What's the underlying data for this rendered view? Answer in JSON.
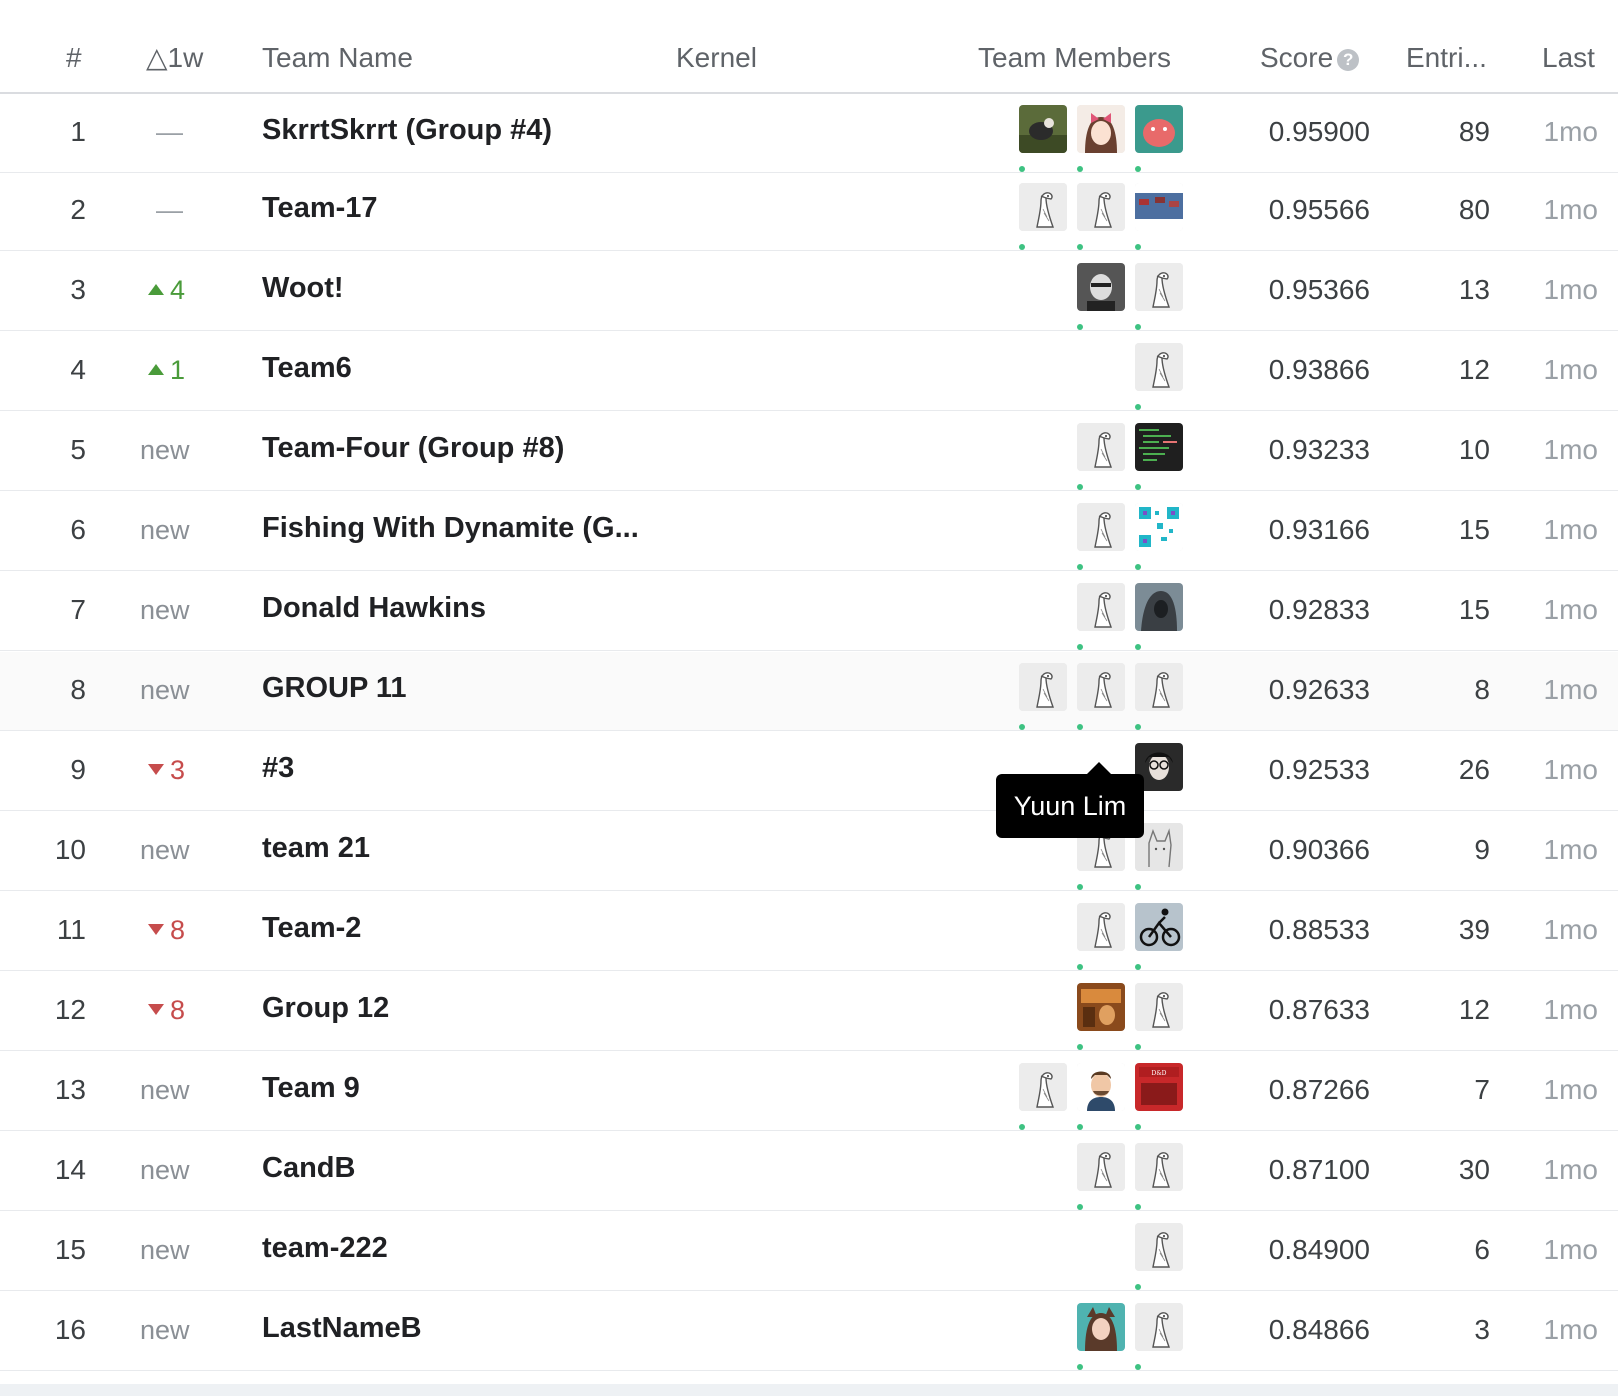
{
  "header": {
    "rank": "#",
    "delta": "△1w",
    "team_name": "Team Name",
    "kernel": "Kernel",
    "members": "Team Members",
    "score": "Score",
    "entries": "Entri...",
    "last": "Last"
  },
  "tooltip": "Yuun Lim",
  "colors": {
    "up": "#4a9b3a",
    "down": "#c64c4c",
    "online_dot": "#3ec282",
    "border": "#dadce0"
  },
  "rows": [
    {
      "rank": "1",
      "delta": "—",
      "delta_type": "same",
      "team": "SkrrtSkrrt (Group #4)",
      "members": [
        "photo-goat",
        "anime-girl",
        "red-pig"
      ],
      "score": "0.95900",
      "entries": "89",
      "last": "1mo"
    },
    {
      "rank": "2",
      "delta": "—",
      "delta_type": "same",
      "team": "Team-17",
      "members": [
        "goose",
        "goose",
        "ships"
      ],
      "score": "0.95566",
      "entries": "80",
      "last": "1mo"
    },
    {
      "rank": "3",
      "delta": "4",
      "delta_type": "up",
      "team": "Woot!",
      "members": [
        "bw-man",
        "goose"
      ],
      "score": "0.95366",
      "entries": "13",
      "last": "1mo"
    },
    {
      "rank": "4",
      "delta": "1",
      "delta_type": "up",
      "team": "Team6",
      "members": [
        "goose"
      ],
      "score": "0.93866",
      "entries": "12",
      "last": "1mo"
    },
    {
      "rank": "5",
      "delta": "new",
      "delta_type": "new",
      "team": "Team-Four (Group #8)",
      "members": [
        "goose",
        "code"
      ],
      "score": "0.93233",
      "entries": "10",
      "last": "1mo"
    },
    {
      "rank": "6",
      "delta": "new",
      "delta_type": "new",
      "team": "Fishing With Dynamite (G...",
      "members": [
        "goose",
        "qr"
      ],
      "score": "0.93166",
      "entries": "15",
      "last": "1mo"
    },
    {
      "rank": "7",
      "delta": "new",
      "delta_type": "new",
      "team": "Donald Hawkins",
      "members": [
        "goose",
        "hooded"
      ],
      "score": "0.92833",
      "entries": "15",
      "last": "1mo"
    },
    {
      "rank": "8",
      "delta": "new",
      "delta_type": "new",
      "team": "GROUP 11",
      "members": [
        "goose",
        "goose",
        "goose"
      ],
      "score": "0.92633",
      "entries": "8",
      "last": "1mo"
    },
    {
      "rank": "9",
      "delta": "3",
      "delta_type": "down",
      "team": "#3",
      "members": [
        "woman-glasses"
      ],
      "score": "0.92533",
      "entries": "26",
      "last": "1mo"
    },
    {
      "rank": "10",
      "delta": "new",
      "delta_type": "new",
      "team": "team 21",
      "members": [
        "goose",
        "cat-sketch"
      ],
      "score": "0.90366",
      "entries": "9",
      "last": "1mo"
    },
    {
      "rank": "11",
      "delta": "8",
      "delta_type": "down",
      "team": "Team-2",
      "members": [
        "goose",
        "cyclist"
      ],
      "score": "0.88533",
      "entries": "39",
      "last": "1mo"
    },
    {
      "rank": "12",
      "delta": "8",
      "delta_type": "down",
      "team": "Group 12",
      "members": [
        "orange-photo",
        "goose"
      ],
      "score": "0.87633",
      "entries": "12",
      "last": "1mo"
    },
    {
      "rank": "13",
      "delta": "new",
      "delta_type": "new",
      "team": "Team 9",
      "members": [
        "goose",
        "cartoon-man",
        "dnd"
      ],
      "score": "0.87266",
      "entries": "7",
      "last": "1mo"
    },
    {
      "rank": "14",
      "delta": "new",
      "delta_type": "new",
      "team": "CandB",
      "members": [
        "goose",
        "goose"
      ],
      "score": "0.87100",
      "entries": "30",
      "last": "1mo"
    },
    {
      "rank": "15",
      "delta": "new",
      "delta_type": "new",
      "team": "team-222",
      "members": [
        "goose"
      ],
      "score": "0.84900",
      "entries": "6",
      "last": "1mo"
    },
    {
      "rank": "16",
      "delta": "new",
      "delta_type": "new",
      "team": "LastNameB",
      "members": [
        "cat-girl",
        "goose"
      ],
      "score": "0.84866",
      "entries": "3",
      "last": "1mo"
    }
  ]
}
